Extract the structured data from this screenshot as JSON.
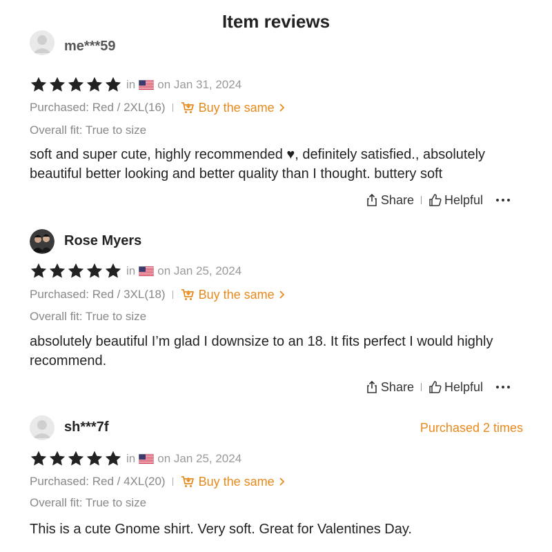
{
  "page": {
    "title": "Item reviews"
  },
  "colors": {
    "accent": "#e8891c",
    "star": "#222222",
    "muted": "#888888"
  },
  "reviews": [
    {
      "username": "me***59",
      "avatar": "default-avatar",
      "rating": 5,
      "in_label": "in",
      "country_flag": "us-flag",
      "date": "on Jan 31, 2024",
      "purchased": "Purchased: Red / 2XL(16)",
      "buy_same": "Buy the same",
      "fit": "Overall fit: True to size",
      "text": "soft and super cute, highly recommended ♥, definitely satisfied., absolutely beautiful better looking and better quality than I thought. buttery soft",
      "share_label": "Share",
      "helpful_label": "Helpful"
    },
    {
      "username": "Rose Myers",
      "avatar": "photo-avatar",
      "rating": 5,
      "in_label": "in",
      "country_flag": "us-flag",
      "date": "on Jan 25, 2024",
      "purchased": "Purchased: Red / 3XL(18)",
      "buy_same": "Buy the same",
      "fit": "Overall fit: True to size",
      "text": "absolutely beautiful I’m glad I downsize to an 18. It fits perfect I would highly recommend.",
      "share_label": "Share",
      "helpful_label": "Helpful"
    },
    {
      "username": "sh***7f",
      "avatar": "default-avatar",
      "purchased_times": "Purchased 2 times",
      "rating": 5,
      "in_label": "in",
      "country_flag": "us-flag",
      "date": "on Jan 25, 2024",
      "purchased": "Purchased: Red / 4XL(20)",
      "buy_same": "Buy the same",
      "fit": "Overall fit: True to size",
      "text": "This is a cute Gnome shirt. Very soft. Great for Valentines Day."
    }
  ]
}
